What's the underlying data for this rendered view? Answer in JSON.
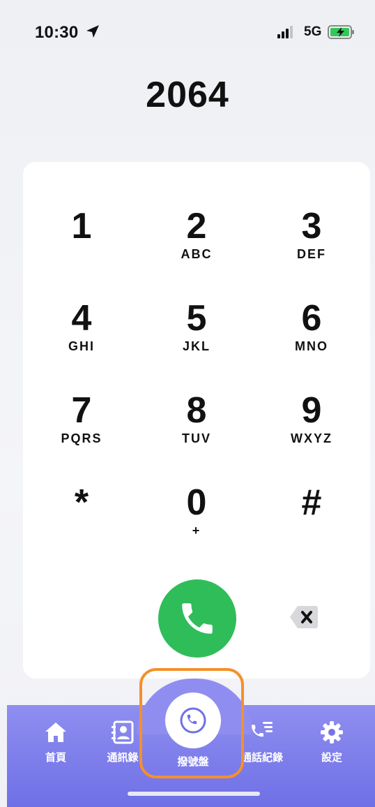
{
  "status_bar": {
    "time": "10:30",
    "network": "5G"
  },
  "dialer": {
    "number": "2064"
  },
  "keypad": {
    "keys": [
      {
        "digit": "1",
        "letters": ""
      },
      {
        "digit": "2",
        "letters": "ABC"
      },
      {
        "digit": "3",
        "letters": "DEF"
      },
      {
        "digit": "4",
        "letters": "GHI"
      },
      {
        "digit": "5",
        "letters": "JKL"
      },
      {
        "digit": "6",
        "letters": "MNO"
      },
      {
        "digit": "7",
        "letters": "PQRS"
      },
      {
        "digit": "8",
        "letters": "TUV"
      },
      {
        "digit": "9",
        "letters": "WXYZ"
      },
      {
        "digit": "*",
        "letters": ""
      },
      {
        "digit": "0",
        "letters": "+"
      },
      {
        "digit": "#",
        "letters": ""
      }
    ]
  },
  "actions": {
    "call_icon": "phone-icon",
    "backspace_icon": "backspace-icon",
    "call_color": "#2fbd5a"
  },
  "tab_bar": {
    "accent": "#7b7be9",
    "highlight_color": "#f5902a",
    "items": [
      {
        "label": "首頁",
        "icon": "home-icon"
      },
      {
        "label": "通訊錄",
        "icon": "contacts-icon"
      },
      {
        "label": "撥號盤",
        "icon": "phone-icon",
        "active": true
      },
      {
        "label": "通話紀錄",
        "icon": "call-log-icon"
      },
      {
        "label": "設定",
        "icon": "gear-icon"
      }
    ]
  }
}
